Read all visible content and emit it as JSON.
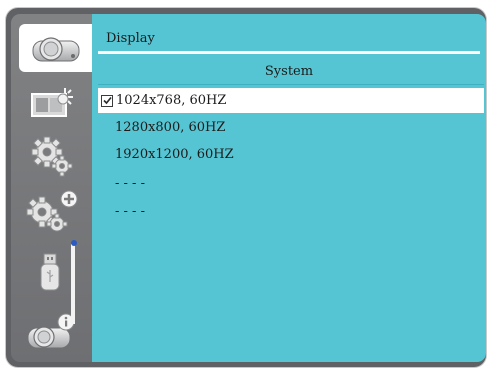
{
  "header": {
    "title": "Display",
    "section": "System"
  },
  "list": {
    "items": [
      {
        "label": "1024x768, 60HZ",
        "checked": true
      },
      {
        "label": "1280x800, 60HZ",
        "checked": false
      },
      {
        "label": "1920x1200, 60HZ",
        "checked": false
      },
      {
        "label": "- - - -",
        "checked": false
      },
      {
        "label": "- - - -",
        "checked": false
      }
    ]
  },
  "sidebar": {
    "items": [
      {
        "icon": "projector-icon",
        "selected": true
      },
      {
        "icon": "image-settings-icon",
        "selected": false
      },
      {
        "icon": "gears-icon",
        "selected": false
      },
      {
        "icon": "advanced-gears-icon",
        "selected": false
      },
      {
        "icon": "usb-icon",
        "selected": false
      },
      {
        "icon": "projector-info-icon",
        "selected": false
      }
    ]
  },
  "colors": {
    "panel": "#56c5d3",
    "sidebar": "#7a7b7d",
    "highlight": "#ffffff",
    "scroll_thumb": "#2b5ac2"
  }
}
